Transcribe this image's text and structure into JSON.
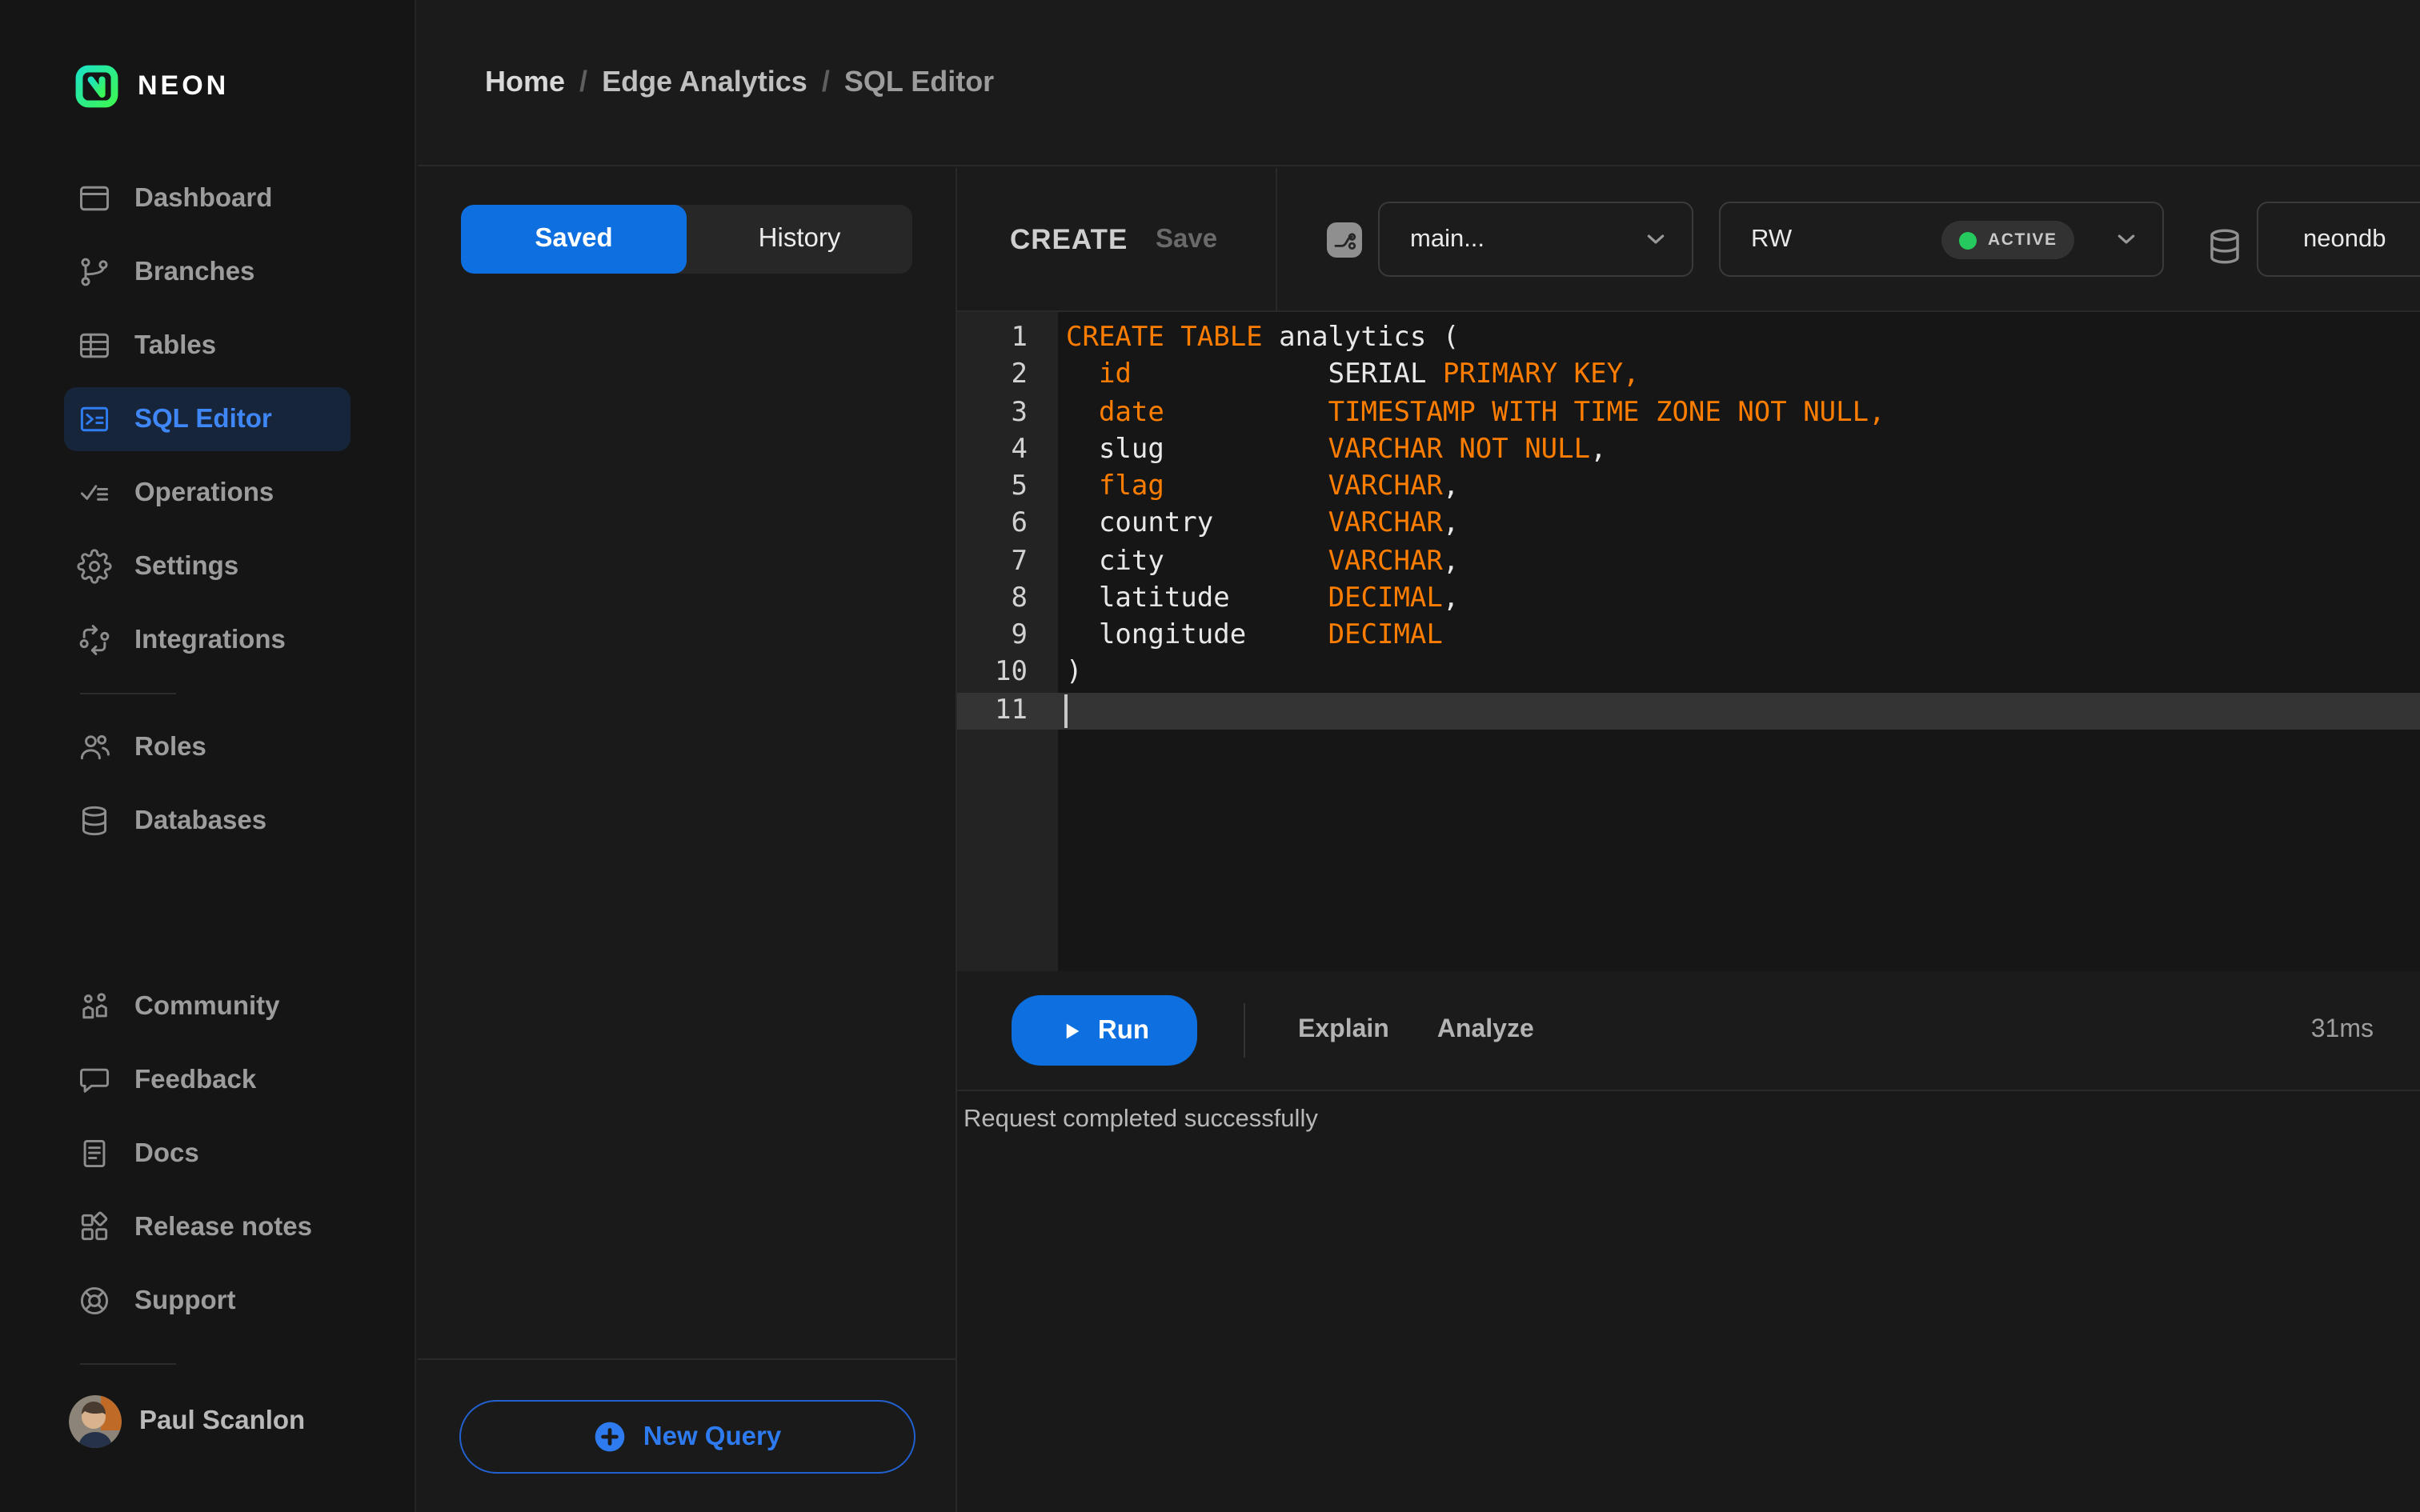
{
  "brand": {
    "logo_text": "NEON"
  },
  "breadcrumb": {
    "separator": "/",
    "items": [
      "Home",
      "Edge Analytics",
      "SQL Editor"
    ]
  },
  "sidebar": {
    "groups": [
      {
        "items": [
          {
            "label": "Dashboard",
            "icon": "dashboard",
            "active": false
          },
          {
            "label": "Branches",
            "icon": "branches",
            "active": false
          },
          {
            "label": "Tables",
            "icon": "tables",
            "active": false
          },
          {
            "label": "SQL Editor",
            "icon": "sql-editor",
            "active": true
          },
          {
            "label": "Operations",
            "icon": "operations",
            "active": false
          },
          {
            "label": "Settings",
            "icon": "settings",
            "active": false
          },
          {
            "label": "Integrations",
            "icon": "integrations",
            "active": false
          }
        ]
      },
      {
        "items": [
          {
            "label": "Roles",
            "icon": "roles",
            "active": false
          },
          {
            "label": "Databases",
            "icon": "databases",
            "active": false
          }
        ]
      },
      {
        "items": [
          {
            "label": "Community",
            "icon": "community",
            "active": false
          },
          {
            "label": "Feedback",
            "icon": "feedback",
            "active": false
          },
          {
            "label": "Docs",
            "icon": "docs",
            "active": false
          },
          {
            "label": "Release notes",
            "icon": "release-notes",
            "active": false
          },
          {
            "label": "Support",
            "icon": "support",
            "active": false
          }
        ]
      }
    ],
    "user": {
      "name": "Paul Scanlon"
    }
  },
  "queries_panel": {
    "tabs": [
      {
        "label": "Saved",
        "active": true
      },
      {
        "label": "History",
        "active": false
      }
    ],
    "new_query_label": "New Query"
  },
  "editor": {
    "query_title": "CREATE",
    "save_label": "Save",
    "branch_select": {
      "value": "main..."
    },
    "compute_select": {
      "value": "RW",
      "status_label": "ACTIVE"
    },
    "database_select": {
      "value": "neondb"
    },
    "code": {
      "cursor_line": 11,
      "lines": [
        {
          "tokens": [
            [
              "CREATE TABLE",
              "k"
            ],
            [
              " analytics (",
              "p"
            ]
          ]
        },
        {
          "tokens": [
            [
              "  ",
              "p"
            ],
            [
              "id",
              "k"
            ],
            [
              "            ",
              "p"
            ],
            [
              "SERIAL ",
              "p"
            ],
            [
              "PRIMARY KEY,",
              "k"
            ]
          ]
        },
        {
          "tokens": [
            [
              "  ",
              "p"
            ],
            [
              "date",
              "k"
            ],
            [
              "          ",
              "p"
            ],
            [
              "TIMESTAMP WITH TIME ZONE NOT NULL,",
              "k"
            ]
          ]
        },
        {
          "tokens": [
            [
              "  slug",
              "p"
            ],
            [
              "          ",
              "p"
            ],
            [
              "VARCHAR NOT NULL",
              "k"
            ],
            [
              ",",
              "p"
            ]
          ]
        },
        {
          "tokens": [
            [
              "  ",
              "p"
            ],
            [
              "flag",
              "k"
            ],
            [
              "          ",
              "p"
            ],
            [
              "VARCHAR",
              "k"
            ],
            [
              ",",
              "p"
            ]
          ]
        },
        {
          "tokens": [
            [
              "  country",
              "p"
            ],
            [
              "       ",
              "p"
            ],
            [
              "VARCHAR",
              "k"
            ],
            [
              ",",
              "p"
            ]
          ]
        },
        {
          "tokens": [
            [
              "  city",
              "p"
            ],
            [
              "          ",
              "p"
            ],
            [
              "VARCHAR",
              "k"
            ],
            [
              ",",
              "p"
            ]
          ]
        },
        {
          "tokens": [
            [
              "  latitude",
              "p"
            ],
            [
              "      ",
              "p"
            ],
            [
              "DECIMAL",
              "k"
            ],
            [
              ",",
              "p"
            ]
          ]
        },
        {
          "tokens": [
            [
              "  longitude",
              "p"
            ],
            [
              "     ",
              "p"
            ],
            [
              "DECIMAL",
              "k"
            ]
          ]
        },
        {
          "tokens": [
            [
              ")",
              "p"
            ]
          ]
        },
        {
          "tokens": []
        }
      ]
    },
    "run_label": "Run",
    "explain_label": "Explain",
    "analyze_label": "Analyze",
    "duration": "31ms",
    "status_message": "Request completed successfully"
  },
  "colors": {
    "accent_blue": "#0d6fe0",
    "sidebar_active_blue": "#3f86f7",
    "keyword_orange": "#ff7d00",
    "status_green": "#25c95d",
    "logo_gradient_start": "#1de3c0",
    "logo_gradient_end": "#3bf655"
  }
}
